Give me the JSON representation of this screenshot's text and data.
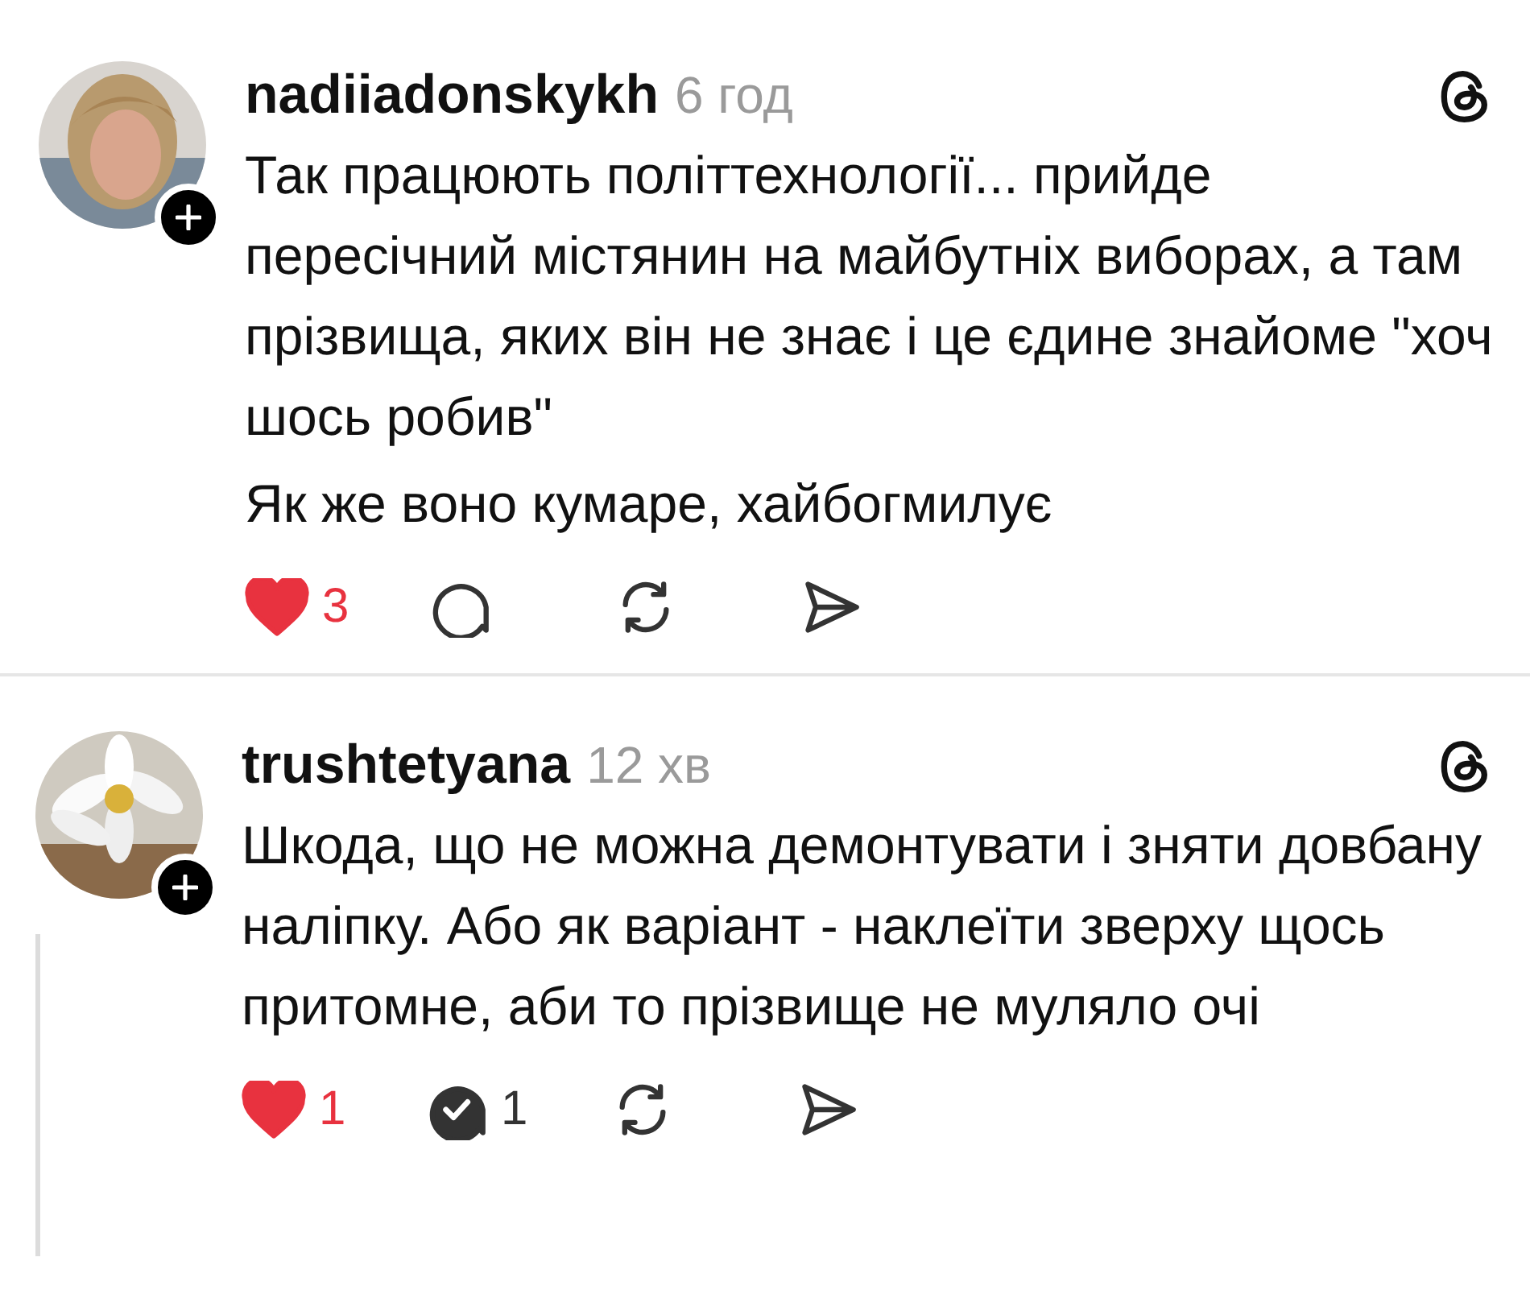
{
  "posts": [
    {
      "username": "nadiiadonskykh",
      "time": "6 год",
      "thread_line": false,
      "paragraphs": [
        "Так працюють політтехнології... прийде пересічний містянин на майбутніх виборах, а там прізвища, яких він не знає і це єдине знайоме \"хоч шось робив\"",
        "Як же воно кумаре, хайбогмилує"
      ],
      "likes": {
        "count": "3",
        "liked": true
      },
      "replies": {
        "replied": false
      },
      "divider": true
    },
    {
      "username": "trushtetyana",
      "time": "12 хв",
      "thread_line": true,
      "paragraphs": [
        "Шкода, що не можна демонтувати і зняти довбану наліпку. Або як варіант - наклеїти зверху щось притомне, аби то прізвище не муляло очі"
      ],
      "likes": {
        "count": "1",
        "liked": true
      },
      "replies": {
        "count": "1",
        "replied": true
      },
      "divider": false
    }
  ]
}
